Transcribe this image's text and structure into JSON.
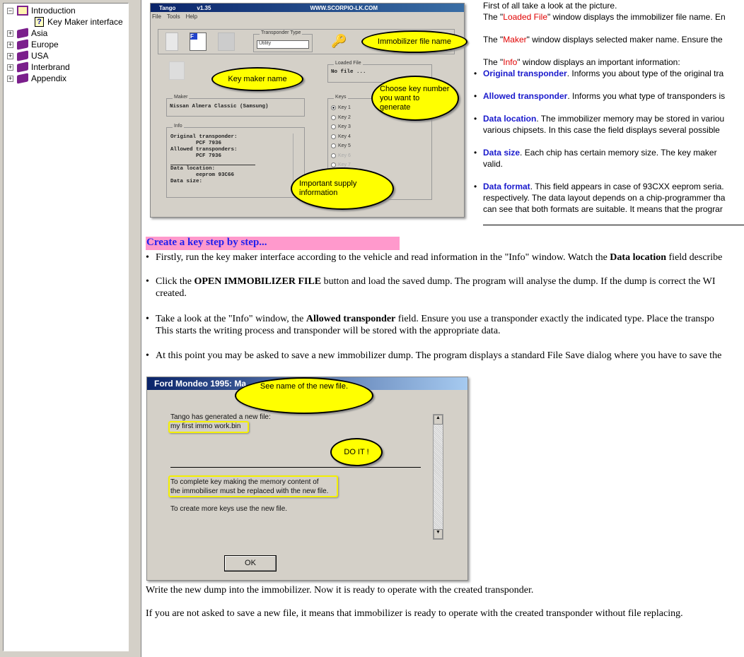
{
  "tree": [
    {
      "label": "Introduction",
      "expanded": true,
      "icon": "open-book-icon"
    },
    {
      "label": "Key Maker interface",
      "icon": "help-page-icon",
      "selected": true
    },
    {
      "label": "Asia",
      "icon": "book-icon"
    },
    {
      "label": "Europe",
      "icon": "book-icon"
    },
    {
      "label": "USA",
      "icon": "book-icon"
    },
    {
      "label": "Interbrand",
      "icon": "book-icon"
    },
    {
      "label": "Appendix",
      "icon": "book-icon"
    }
  ],
  "shot1": {
    "title": "Tango",
    "version": "v1.35",
    "site": "WWW.SCORPIO-LK.COM",
    "menu": [
      "File",
      "Tools",
      "Help"
    ],
    "transponder_type_label": "Transponder Type",
    "transponder_type_value": "Utility",
    "loaded_file_label": "Loaded File",
    "loaded_file_value": "No file ...",
    "maker_label": "Maker",
    "maker_value": "Nissan Almera Classic (Samsung)",
    "info_label": "Info",
    "info_lines": [
      "Original transponder:",
      "        PCF 7936",
      "Allowed transponders:",
      "        PCF 7936",
      "",
      "Data location:",
      "        eeprom 93C66",
      "Data size:"
    ],
    "keys_label": "Keys",
    "keys": [
      "Key 1",
      "Key 2",
      "Key 3",
      "Key 4",
      "Key 5",
      "Key 6",
      "Key 7"
    ],
    "balloons": {
      "file": "Immobilizer file name",
      "maker": "Key maker name",
      "keys": "Choose key number you want to generate",
      "info": "Important supply information"
    }
  },
  "intro": {
    "l1": "First of all take a look at the picture.",
    "l2a": "The \"",
    "l2b": "Loaded File",
    "l2c": "\" window displays the immobilizer file name. En",
    "l3a": "The \"",
    "l3b": "Maker",
    "l3c": "\" window displays selected maker name. Ensure the",
    "l4a": "The \"",
    "l4b": "Info",
    "l4c": "\" window displays an important information:",
    "bullets": [
      {
        "term": "Original transponder",
        "text": ". Informs you about type of the original tra",
        "text2": ""
      },
      {
        "term": "Allowed transponder",
        "text": ". Informs you what type of transponders is",
        "text2": ""
      },
      {
        "term": "Data location",
        "text": ". The immobilizer memory may be stored in variou",
        "text2": "various chipsets. In this case the field displays several possible"
      },
      {
        "term": "Data size",
        "text": ". Each chip has certain memory size. The key maker",
        "text2": "valid."
      },
      {
        "term": "Data format",
        "text": ". This field appears in case of 93CXX eeprom seria.",
        "text2": "respectively. The data layout depends on a chip-programmer tha",
        "text3": "can see that both formats are suitable. It means that the prograr"
      }
    ]
  },
  "steps": {
    "heading": "Create a key step by step...",
    "s1a": "Firstly, run the key maker interface according to the vehicle and read information in the \"Info\" window. Watch the ",
    "s1b": "Data location",
    "s1c": " field describe",
    "s2a": "Click the ",
    "s2b": "OPEN IMMOBILIZER FILE",
    "s2c": " button and load the saved dump. The program will analyse the dump. If the dump is correct the WI",
    "s2d": "created.",
    "s3a": "Take a look at the \"Info\" window, the ",
    "s3b": "Allowed transponder",
    "s3c": " field. Ensure you use a transponder exactly the indicated type. Place the transpo",
    "s3d": "This starts the writing process and transponder will be stored with the appropriate data.",
    "s4": "At this point you may be asked to save a new immobilizer dump. The program displays a standard File Save dialog where you have to save the"
  },
  "shot2": {
    "title": "Ford Mondeo 1995:  Ma",
    "line1": "Tango has generated a new file:",
    "filename": "my first immo work.bin",
    "msg1": "To complete key making the memory content of",
    "msg2": "the immobiliser must be replaced with the new file.",
    "msg3": "To create more keys use the new file.",
    "ok": "OK",
    "balloons": {
      "name": "See name of the new file.",
      "doit": "DO IT !"
    }
  },
  "after1": "Write the new dump into the immobilizer. Now it is ready to operate with the created transponder.",
  "after2": "If you are not asked to save a new file, it means that immobilizer is ready to operate with the created transponder without file replacing.",
  "colors": {
    "accent_red": "#e00000",
    "term_blue": "#1a1acc",
    "heading_bg": "#ff99cc",
    "balloon": "#ffff00"
  }
}
